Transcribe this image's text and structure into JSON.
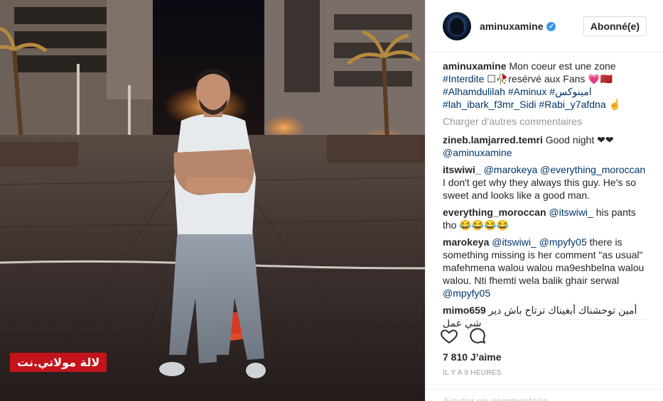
{
  "photo": {
    "watermark": "لالة مولاتي.نت"
  },
  "post": {
    "username": "aminuxamine",
    "follow_label": "Abonné(e)",
    "caption_user": "aminuxamine",
    "caption_line1": "Mon coeur est une zone",
    "caption_tag1": "#Interdite",
    "caption_line2": "☐🥀resérvé aux Fans 💗🇲🇦",
    "caption_tag2": "#Alhamdulilah",
    "caption_tag3": "#Aminux",
    "caption_tag4": "#امينوكس",
    "caption_tag5": "#lah_ibark_f3mr_Sidi",
    "caption_tag6": "#Rabi_y7afdna",
    "caption_emoji": "☝",
    "load_more": "Charger d’autres commentaires",
    "likes": "7 810 J’aime",
    "timestamp": "IL Y A 9 HEURES",
    "add_comment_placeholder": "Ajouter un commentaire..."
  },
  "comments": [
    {
      "user": "zineb.lamjarred.temri",
      "text": "Good night ❤❤",
      "mention": "@aminuxamine"
    },
    {
      "user": "itswiwi_",
      "mention1": "@marokeya",
      "mention2": "@everything_moroccan",
      "text": "I don't get why they always this guy. He's so sweet and looks like a good man."
    },
    {
      "user": "everything_moroccan",
      "mention": "@itswiwi_",
      "text": "his pants tho 😂😂😂😂"
    },
    {
      "user": "marokeya",
      "mention1": "@itswiwi_",
      "mention2": "@mpyfy05",
      "text": "there is something missing is her comment \"as usual\" mafehmena walou walou ma9eshbelna walou walou. Nti fhemti wela balik ghair serwal",
      "mention3": "@mpyfy05"
    },
    {
      "user": "mimo659",
      "text": "أمين توحشناك أبغيناك ترتاح باش دير شي عمل"
    }
  ]
}
